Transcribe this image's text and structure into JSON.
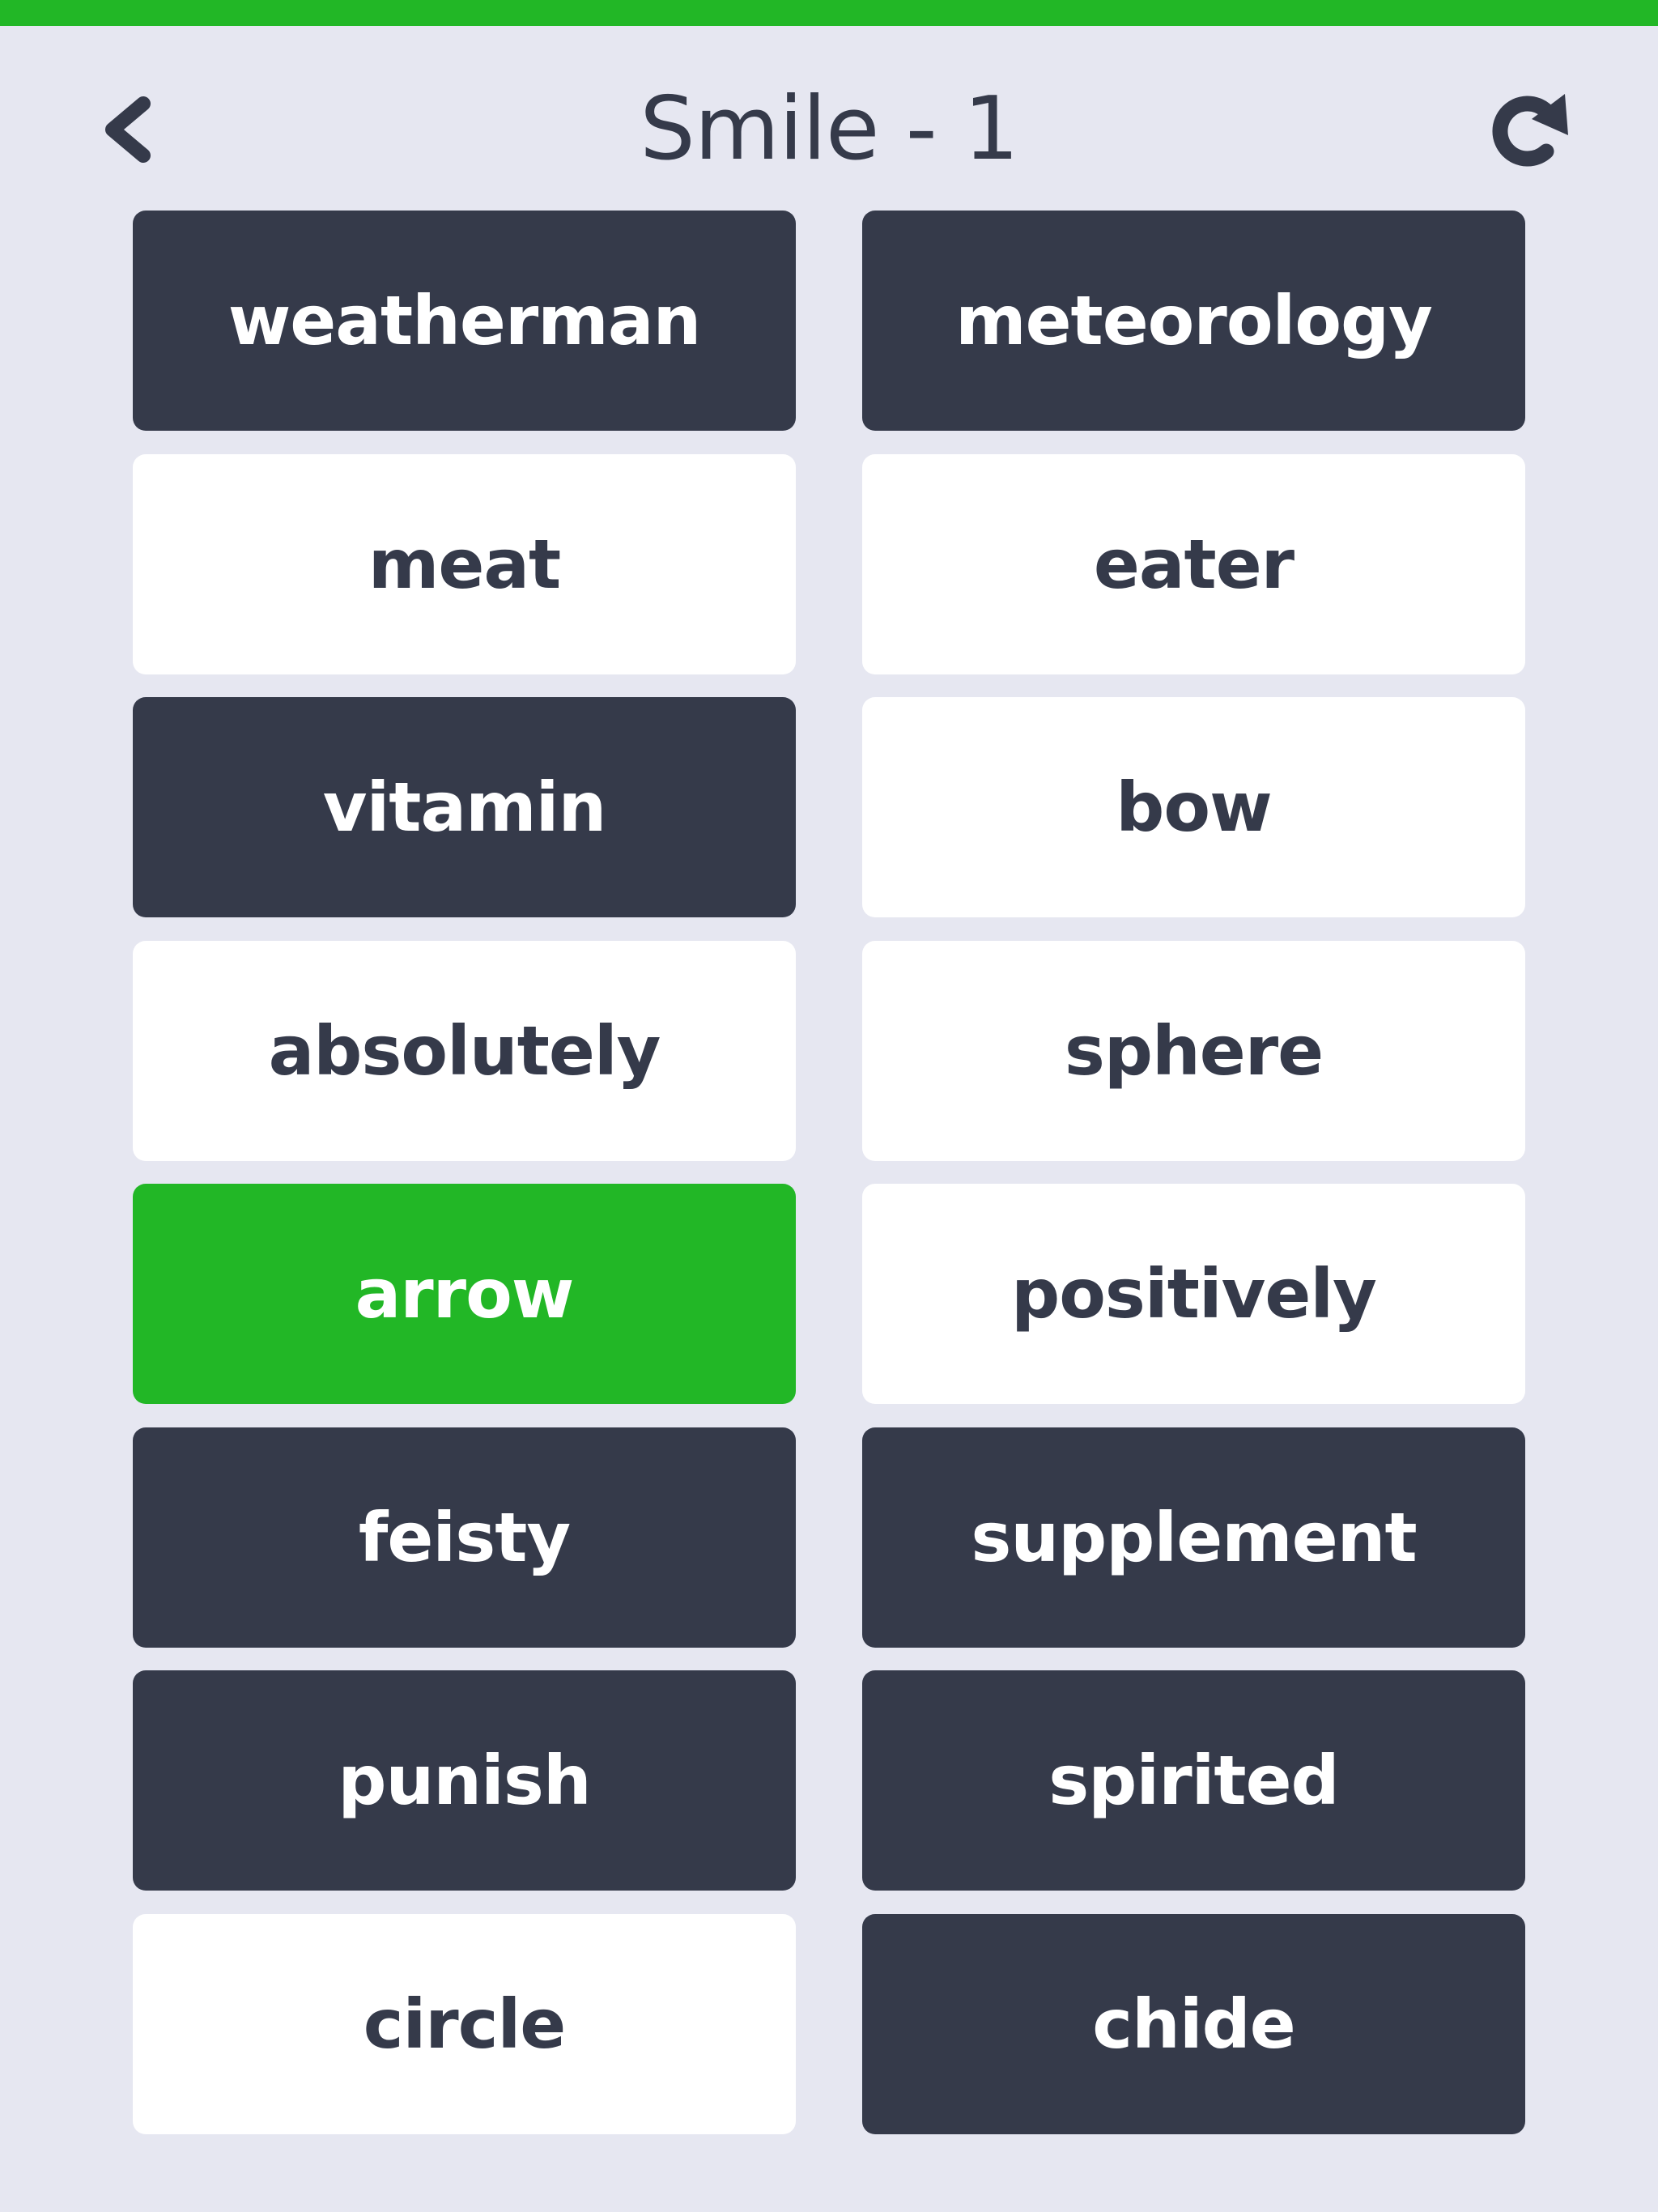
{
  "progress": {
    "fraction": 1.0,
    "color": "#22b726"
  },
  "header": {
    "title": "Smile - 1",
    "back_icon": "chevron-left-icon",
    "refresh_icon": "refresh-icon"
  },
  "colors": {
    "background": "#e6e7f1",
    "dark_card": "#353a4a",
    "light_card": "#ffffff",
    "selected_card": "#22b726",
    "text_dark": "#353a4a",
    "text_light": "#ffffff"
  },
  "cards": [
    {
      "word": "weatherman",
      "state": "dark"
    },
    {
      "word": "meteorology",
      "state": "dark"
    },
    {
      "word": "meat",
      "state": "light"
    },
    {
      "word": "eater",
      "state": "light"
    },
    {
      "word": "vitamin",
      "state": "dark"
    },
    {
      "word": "bow",
      "state": "light"
    },
    {
      "word": "absolutely",
      "state": "light"
    },
    {
      "word": "sphere",
      "state": "light"
    },
    {
      "word": "arrow",
      "state": "selected"
    },
    {
      "word": "positively",
      "state": "light"
    },
    {
      "word": "feisty",
      "state": "dark"
    },
    {
      "word": "supplement",
      "state": "dark"
    },
    {
      "word": "punish",
      "state": "dark"
    },
    {
      "word": "spirited",
      "state": "dark"
    },
    {
      "word": "circle",
      "state": "light"
    },
    {
      "word": "chide",
      "state": "dark"
    }
  ]
}
